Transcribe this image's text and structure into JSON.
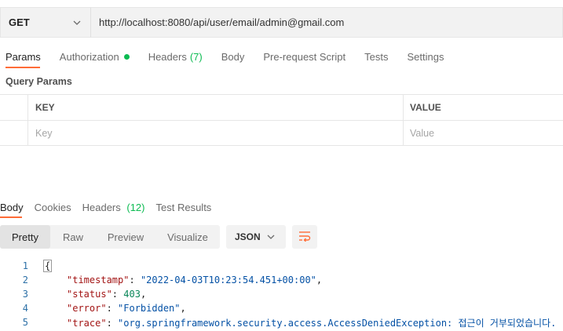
{
  "request": {
    "method": "GET",
    "url": "http://localhost:8080/api/user/email/admin@gmail.com"
  },
  "request_tabs": [
    {
      "label": "Params",
      "active": true
    },
    {
      "label": "Authorization",
      "has_dot": true
    },
    {
      "label": "Headers",
      "count": "(7)"
    },
    {
      "label": "Body"
    },
    {
      "label": "Pre-request Script"
    },
    {
      "label": "Tests"
    },
    {
      "label": "Settings"
    }
  ],
  "query_params": {
    "title": "Query Params",
    "columns": [
      "KEY",
      "VALUE"
    ],
    "placeholder_key": "Key",
    "placeholder_value": "Value"
  },
  "response_tabs": [
    {
      "label": "Body",
      "active": true
    },
    {
      "label": "Cookies"
    },
    {
      "label": "Headers",
      "count": "(12)"
    },
    {
      "label": "Test Results"
    }
  ],
  "view_modes": [
    "Pretty",
    "Raw",
    "Preview",
    "Visualize"
  ],
  "format": "JSON",
  "colors": {
    "accent": "#ff6c37",
    "success": "#0cbb52",
    "json_key": "#a31515",
    "json_string": "#0451a5",
    "json_number": "#098658"
  },
  "code_lines": [
    {
      "n": "1",
      "brace": "{"
    },
    {
      "n": "2",
      "key": "\"timestamp\"",
      "sep": ": ",
      "value": "\"2022-04-03T10:23:54.451+00:00\"",
      "vtype": "s",
      "tail": ","
    },
    {
      "n": "3",
      "key": "\"status\"",
      "sep": ": ",
      "value": "403",
      "vtype": "n",
      "tail": ","
    },
    {
      "n": "4",
      "key": "\"error\"",
      "sep": ": ",
      "value": "\"Forbidden\"",
      "vtype": "s",
      "tail": ","
    },
    {
      "n": "5",
      "key": "\"trace\"",
      "sep": ": ",
      "value": "\"org.springframework.security.access.AccessDeniedException: 접근이 거부되었습니다.",
      "vtype": "s",
      "tail": ""
    }
  ]
}
